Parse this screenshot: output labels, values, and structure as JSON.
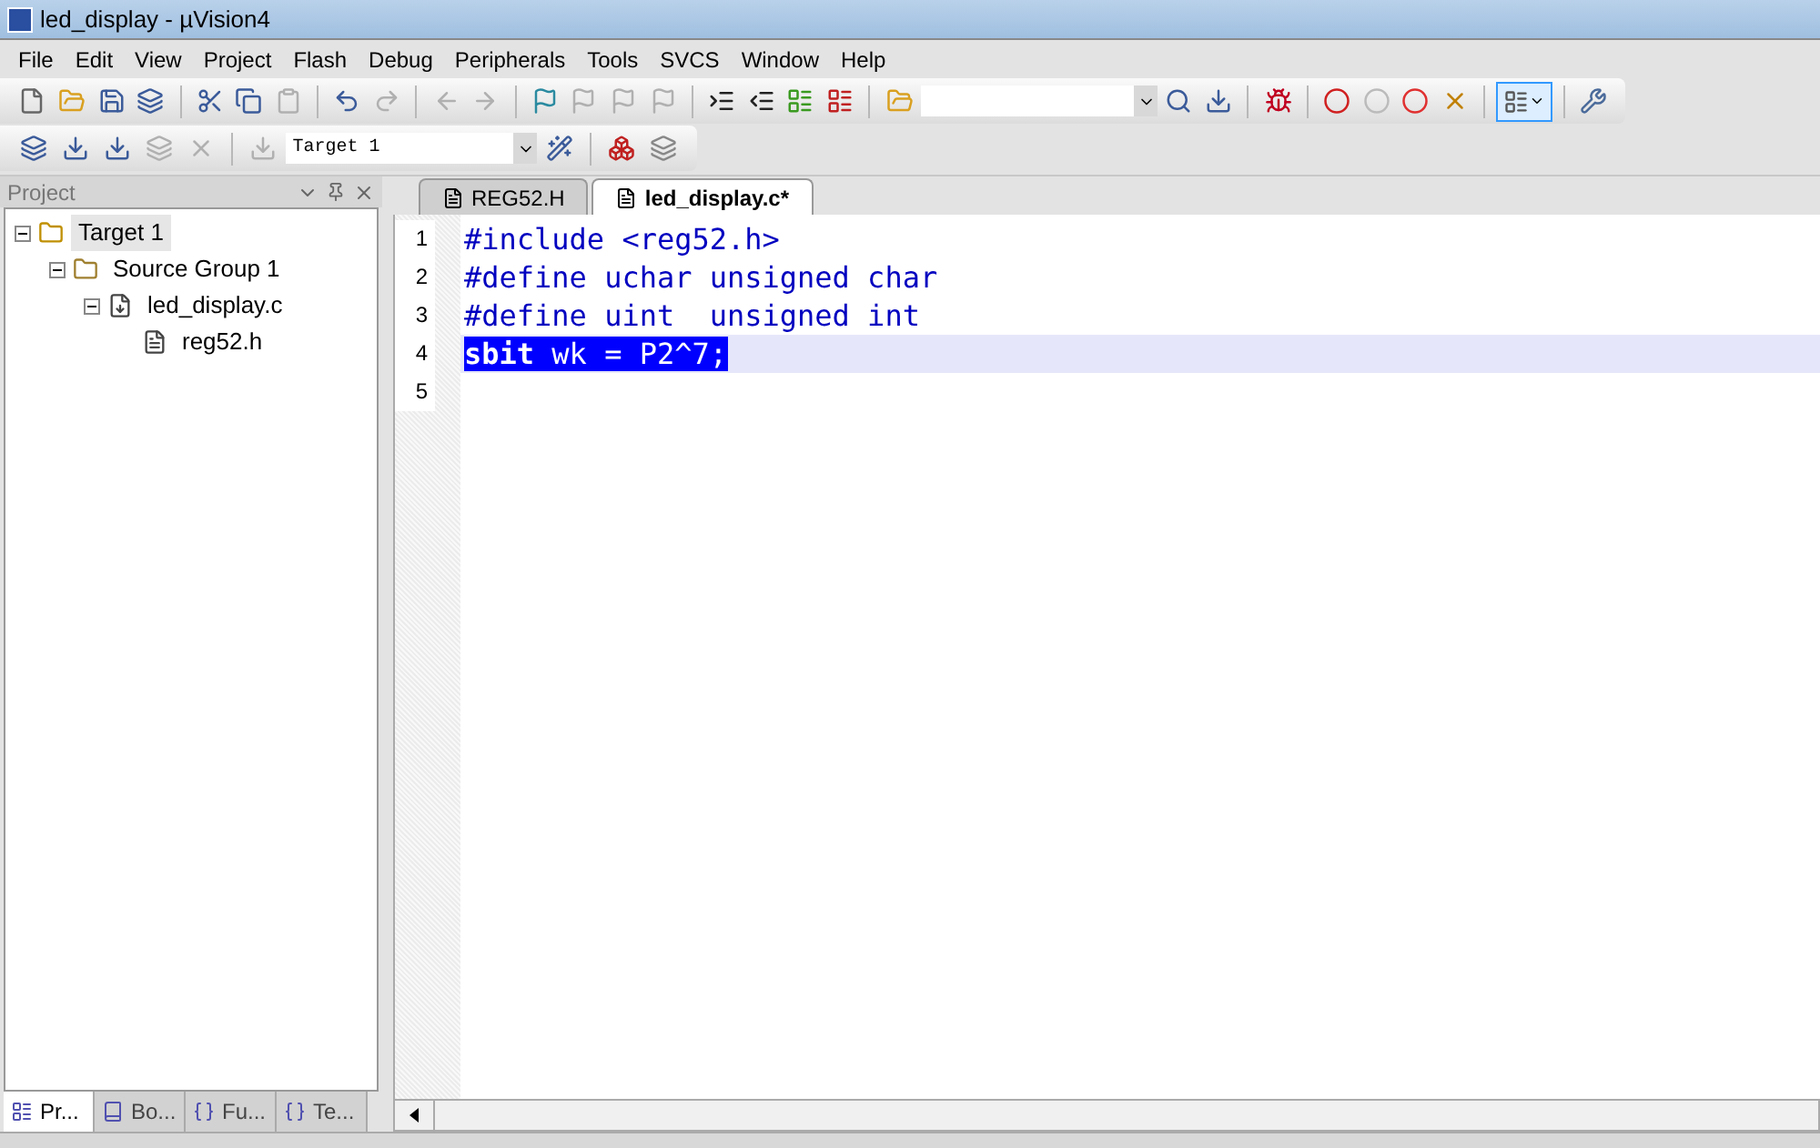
{
  "window": {
    "title": "led_display  - µVision4"
  },
  "menu": [
    {
      "label": "File"
    },
    {
      "label": "Edit"
    },
    {
      "label": "View"
    },
    {
      "label": "Project"
    },
    {
      "label": "Flash"
    },
    {
      "label": "Debug"
    },
    {
      "label": "Peripherals"
    },
    {
      "label": "Tools"
    },
    {
      "label": "SVCS"
    },
    {
      "label": "Window"
    },
    {
      "label": "Help"
    }
  ],
  "toolbar": {
    "target_select": {
      "value": "Target 1"
    }
  },
  "project_panel": {
    "title": "Project",
    "tree": [
      {
        "label": "Target 1",
        "kind": "target",
        "selected": true,
        "expanded": true,
        "children": [
          {
            "label": "Source Group 1",
            "kind": "group",
            "selected": false,
            "expanded": true,
            "children": [
              {
                "label": "led_display.c",
                "kind": "source",
                "selected": false,
                "expanded": true,
                "children": [
                  {
                    "label": "reg52.h",
                    "kind": "header",
                    "selected": false
                  }
                ]
              }
            ]
          }
        ]
      }
    ],
    "tabs": [
      {
        "label": "Pr...",
        "kind": "project",
        "selected": true
      },
      {
        "label": "Bo...",
        "kind": "books",
        "selected": false
      },
      {
        "label": "Fu...",
        "kind": "functions",
        "selected": false
      },
      {
        "label": "Te...",
        "kind": "templates",
        "selected": false
      }
    ]
  },
  "editor": {
    "tabs": [
      {
        "label": "REG52.H",
        "selected": false
      },
      {
        "label": "led_display.c*",
        "selected": true
      }
    ],
    "lines": [
      {
        "number": "1",
        "selected": false,
        "tokens": [
          {
            "text": "#include <reg52.h>",
            "kind": "keyword"
          }
        ]
      },
      {
        "number": "2",
        "selected": false,
        "tokens": [
          {
            "text": "#define uchar unsigned char",
            "kind": "keyword"
          }
        ]
      },
      {
        "number": "3",
        "selected": false,
        "tokens": [
          {
            "text": "#define uint  unsigned int",
            "kind": "keyword"
          }
        ]
      },
      {
        "number": "4",
        "selected": true,
        "tokens": [
          {
            "text": "sbit",
            "kind": "bold"
          },
          {
            "text": " wk = P2^7;",
            "kind": "plain"
          }
        ]
      },
      {
        "number": "5",
        "selected": false
      }
    ]
  }
}
